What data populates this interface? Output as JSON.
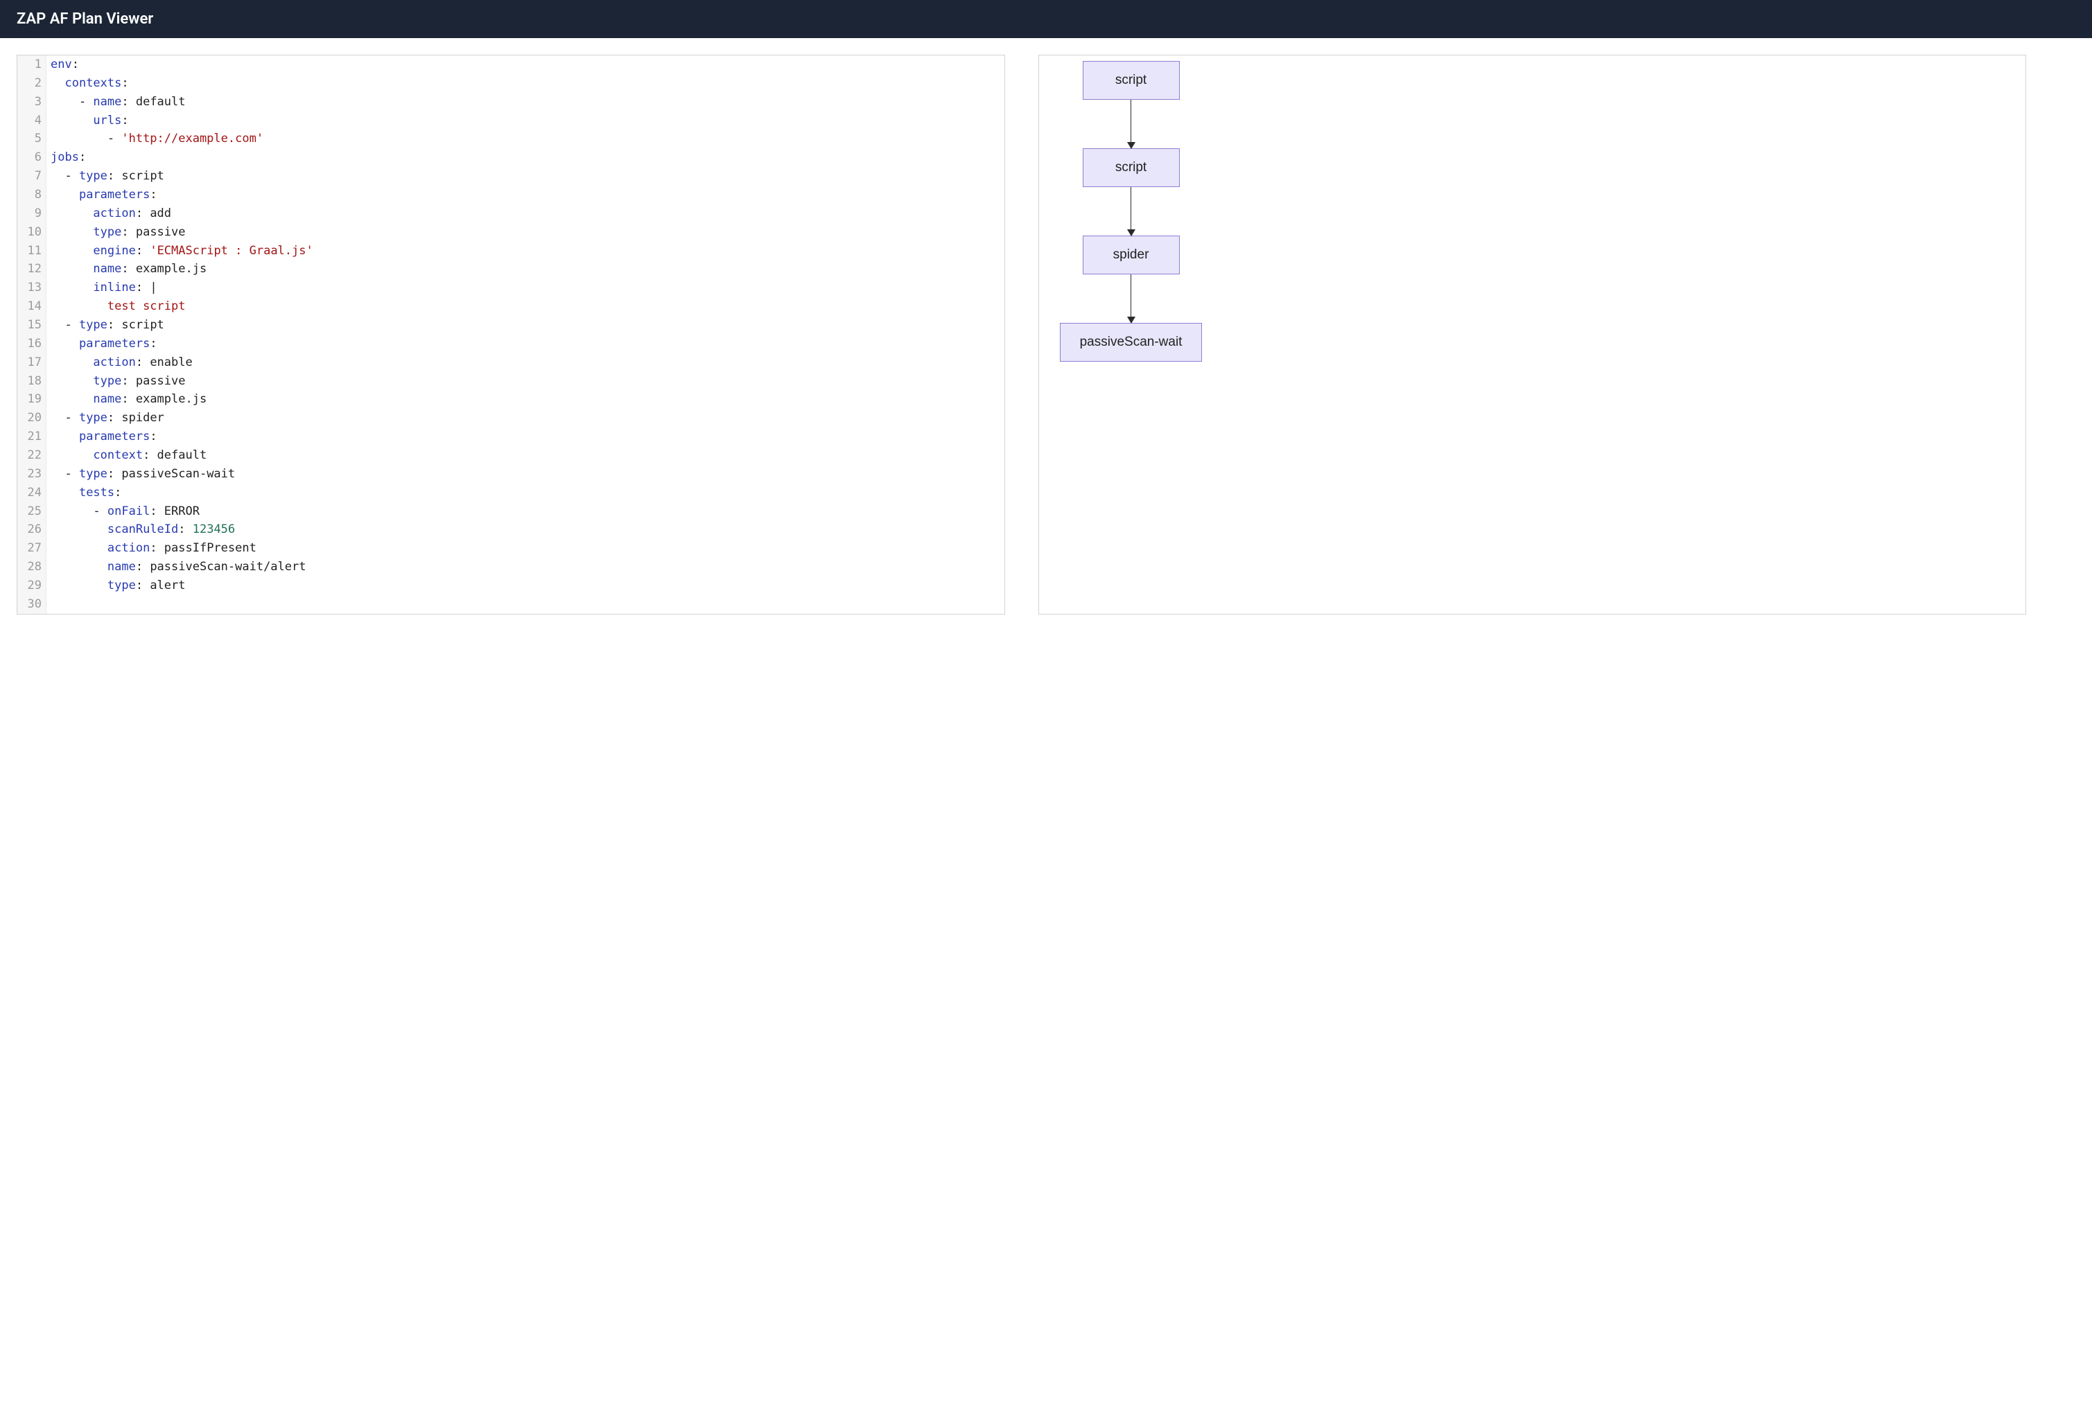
{
  "header": {
    "title": "ZAP AF Plan Viewer"
  },
  "editor": {
    "lines": [
      {
        "n": 1,
        "segments": [
          {
            "cls": "tok-key",
            "t": "env"
          },
          {
            "cls": "tok-plain",
            "t": ":"
          }
        ]
      },
      {
        "n": 2,
        "segments": [
          {
            "cls": "tok-plain",
            "t": "  "
          },
          {
            "cls": "tok-key",
            "t": "contexts"
          },
          {
            "cls": "tok-plain",
            "t": ":"
          }
        ]
      },
      {
        "n": 3,
        "segments": [
          {
            "cls": "tok-plain",
            "t": "    - "
          },
          {
            "cls": "tok-key",
            "t": "name"
          },
          {
            "cls": "tok-plain",
            "t": ": default"
          }
        ]
      },
      {
        "n": 4,
        "segments": [
          {
            "cls": "tok-plain",
            "t": "      "
          },
          {
            "cls": "tok-key",
            "t": "urls"
          },
          {
            "cls": "tok-plain",
            "t": ":"
          }
        ]
      },
      {
        "n": 5,
        "segments": [
          {
            "cls": "tok-plain",
            "t": "        - "
          },
          {
            "cls": "tok-str",
            "t": "'http://example.com'"
          }
        ]
      },
      {
        "n": 6,
        "segments": [
          {
            "cls": "tok-key",
            "t": "jobs"
          },
          {
            "cls": "tok-plain",
            "t": ":"
          }
        ]
      },
      {
        "n": 7,
        "segments": [
          {
            "cls": "tok-plain",
            "t": "  - "
          },
          {
            "cls": "tok-key",
            "t": "type"
          },
          {
            "cls": "tok-plain",
            "t": ": script"
          }
        ]
      },
      {
        "n": 8,
        "segments": [
          {
            "cls": "tok-plain",
            "t": "    "
          },
          {
            "cls": "tok-key",
            "t": "parameters"
          },
          {
            "cls": "tok-plain",
            "t": ":"
          }
        ]
      },
      {
        "n": 9,
        "segments": [
          {
            "cls": "tok-plain",
            "t": "      "
          },
          {
            "cls": "tok-key",
            "t": "action"
          },
          {
            "cls": "tok-plain",
            "t": ": add"
          }
        ]
      },
      {
        "n": 10,
        "segments": [
          {
            "cls": "tok-plain",
            "t": "      "
          },
          {
            "cls": "tok-key",
            "t": "type"
          },
          {
            "cls": "tok-plain",
            "t": ": passive"
          }
        ]
      },
      {
        "n": 11,
        "segments": [
          {
            "cls": "tok-plain",
            "t": "      "
          },
          {
            "cls": "tok-key",
            "t": "engine"
          },
          {
            "cls": "tok-plain",
            "t": ": "
          },
          {
            "cls": "tok-str",
            "t": "'ECMAScript : Graal.js'"
          }
        ]
      },
      {
        "n": 12,
        "segments": [
          {
            "cls": "tok-plain",
            "t": "      "
          },
          {
            "cls": "tok-key",
            "t": "name"
          },
          {
            "cls": "tok-plain",
            "t": ": example.js"
          }
        ]
      },
      {
        "n": 13,
        "segments": [
          {
            "cls": "tok-plain",
            "t": "      "
          },
          {
            "cls": "tok-key",
            "t": "inline"
          },
          {
            "cls": "tok-plain",
            "t": ": |"
          }
        ]
      },
      {
        "n": 14,
        "segments": [
          {
            "cls": "tok-plain",
            "t": "        "
          },
          {
            "cls": "tok-str",
            "t": "test script"
          }
        ]
      },
      {
        "n": 15,
        "segments": [
          {
            "cls": "tok-plain",
            "t": "  - "
          },
          {
            "cls": "tok-key",
            "t": "type"
          },
          {
            "cls": "tok-plain",
            "t": ": script"
          }
        ]
      },
      {
        "n": 16,
        "segments": [
          {
            "cls": "tok-plain",
            "t": "    "
          },
          {
            "cls": "tok-key",
            "t": "parameters"
          },
          {
            "cls": "tok-plain",
            "t": ":"
          }
        ]
      },
      {
        "n": 17,
        "segments": [
          {
            "cls": "tok-plain",
            "t": "      "
          },
          {
            "cls": "tok-key",
            "t": "action"
          },
          {
            "cls": "tok-plain",
            "t": ": enable"
          }
        ]
      },
      {
        "n": 18,
        "segments": [
          {
            "cls": "tok-plain",
            "t": "      "
          },
          {
            "cls": "tok-key",
            "t": "type"
          },
          {
            "cls": "tok-plain",
            "t": ": passive"
          }
        ]
      },
      {
        "n": 19,
        "segments": [
          {
            "cls": "tok-plain",
            "t": "      "
          },
          {
            "cls": "tok-key",
            "t": "name"
          },
          {
            "cls": "tok-plain",
            "t": ": example.js"
          }
        ]
      },
      {
        "n": 20,
        "segments": [
          {
            "cls": "tok-plain",
            "t": "  - "
          },
          {
            "cls": "tok-key",
            "t": "type"
          },
          {
            "cls": "tok-plain",
            "t": ": spider"
          }
        ]
      },
      {
        "n": 21,
        "segments": [
          {
            "cls": "tok-plain",
            "t": "    "
          },
          {
            "cls": "tok-key",
            "t": "parameters"
          },
          {
            "cls": "tok-plain",
            "t": ":"
          }
        ]
      },
      {
        "n": 22,
        "segments": [
          {
            "cls": "tok-plain",
            "t": "      "
          },
          {
            "cls": "tok-key",
            "t": "context"
          },
          {
            "cls": "tok-plain",
            "t": ": default"
          }
        ]
      },
      {
        "n": 23,
        "segments": [
          {
            "cls": "tok-plain",
            "t": "  - "
          },
          {
            "cls": "tok-key",
            "t": "type"
          },
          {
            "cls": "tok-plain",
            "t": ": passiveScan-wait"
          }
        ]
      },
      {
        "n": 24,
        "segments": [
          {
            "cls": "tok-plain",
            "t": "    "
          },
          {
            "cls": "tok-key",
            "t": "tests"
          },
          {
            "cls": "tok-plain",
            "t": ":"
          }
        ]
      },
      {
        "n": 25,
        "segments": [
          {
            "cls": "tok-plain",
            "t": "      - "
          },
          {
            "cls": "tok-key",
            "t": "onFail"
          },
          {
            "cls": "tok-plain",
            "t": ": ERROR"
          }
        ]
      },
      {
        "n": 26,
        "segments": [
          {
            "cls": "tok-plain",
            "t": "        "
          },
          {
            "cls": "tok-key",
            "t": "scanRuleId"
          },
          {
            "cls": "tok-plain",
            "t": ": "
          },
          {
            "cls": "tok-num",
            "t": "123456"
          }
        ]
      },
      {
        "n": 27,
        "segments": [
          {
            "cls": "tok-plain",
            "t": "        "
          },
          {
            "cls": "tok-key",
            "t": "action"
          },
          {
            "cls": "tok-plain",
            "t": ": passIfPresent"
          }
        ]
      },
      {
        "n": 28,
        "segments": [
          {
            "cls": "tok-plain",
            "t": "        "
          },
          {
            "cls": "tok-key",
            "t": "name"
          },
          {
            "cls": "tok-plain",
            "t": ": passiveScan-wait/alert"
          }
        ]
      },
      {
        "n": 29,
        "segments": [
          {
            "cls": "tok-plain",
            "t": "        "
          },
          {
            "cls": "tok-key",
            "t": "type"
          },
          {
            "cls": "tok-plain",
            "t": ": alert"
          }
        ]
      },
      {
        "n": 30,
        "segments": [
          {
            "cls": "tok-plain",
            "t": ""
          }
        ]
      }
    ]
  },
  "diagram": {
    "nodes": [
      {
        "label": "script"
      },
      {
        "label": "script"
      },
      {
        "label": "spider"
      },
      {
        "label": "passiveScan-wait"
      }
    ]
  },
  "plan": {
    "env": {
      "contexts": [
        {
          "name": "default",
          "urls": [
            "http://example.com"
          ]
        }
      ]
    },
    "jobs": [
      {
        "type": "script",
        "parameters": {
          "action": "add",
          "type": "passive",
          "engine": "ECMAScript : Graal.js",
          "name": "example.js",
          "inline": "test script"
        }
      },
      {
        "type": "script",
        "parameters": {
          "action": "enable",
          "type": "passive",
          "name": "example.js"
        }
      },
      {
        "type": "spider",
        "parameters": {
          "context": "default"
        }
      },
      {
        "type": "passiveScan-wait",
        "tests": [
          {
            "onFail": "ERROR",
            "scanRuleId": 123456,
            "action": "passIfPresent",
            "name": "passiveScan-wait/alert",
            "type": "alert"
          }
        ]
      }
    ]
  }
}
